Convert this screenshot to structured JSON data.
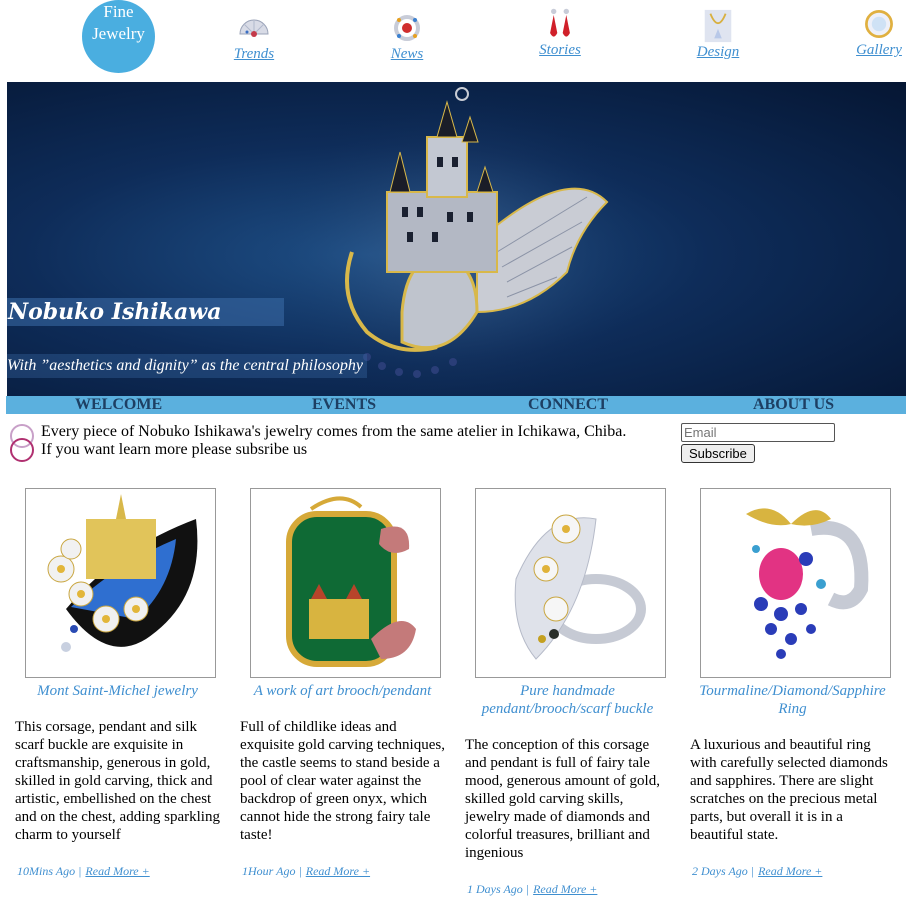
{
  "logo": {
    "line1": "Fine",
    "line2": "Jewelry"
  },
  "nav": [
    {
      "label": "Trends",
      "icon": "fan-earring-icon"
    },
    {
      "label": "News",
      "icon": "ring-icon"
    },
    {
      "label": "Stories",
      "icon": "earrings-icon"
    },
    {
      "label": "Design",
      "icon": "necklace-icon"
    },
    {
      "label": "Gallery",
      "icon": "pendant-icon"
    }
  ],
  "hero": {
    "title": "Nobuko Ishikawa",
    "subtitle": "With ”aesthetics and dignity” as the central philosophy"
  },
  "menu": [
    "WELCOME",
    "EVENTS",
    "CONNECT",
    "ABOUT US"
  ],
  "intro": {
    "line1": "Every piece of Nobuko Ishikawa's jewelry comes from the same atelier in Ichikawa, Chiba.",
    "line2": "If you want learn more please subsribe us"
  },
  "subscribe": {
    "placeholder": "Email",
    "button": "Subscribe"
  },
  "cards": [
    {
      "caption": "Mont Saint-Michel jewelry",
      "description": "This corsage, pendant and silk scarf buckle are exquisite in craftsmanship, generous in gold, skilled in gold carving, thick and artistic, embellished on the chest and on the chest, adding sparkling charm to yourself",
      "time": "10Mins Ago |",
      "read_more": "Read More +"
    },
    {
      "caption": "A work of art brooch/pendant",
      "description": "Full of childlike ideas and exquisite gold carving techniques, the castle seems to stand beside a pool of clear water against the backdrop of green onyx, which cannot hide the strong fairy tale taste!",
      "time": "1Hour Ago |",
      "read_more": "Read More +"
    },
    {
      "caption": "Pure handmade pendant/brooch/scarf buckle",
      "description": "The conception of this corsage and pendant is full of fairy tale mood, generous amount of gold, skilled gold carving skills, jewelry made of diamonds and colorful treasures, brilliant and ingenious",
      "time": "1 Days Ago |",
      "read_more": "Read More +"
    },
    {
      "caption": "Tourmaline/Diamond/Sapphire Ring",
      "description": "A luxurious and beautiful ring with carefully selected diamonds and sapphires. There are slight scratches on the precious metal parts, but overall it is in a beautiful state.",
      "time": "2 Days Ago |",
      "read_more": "Read More +"
    }
  ]
}
